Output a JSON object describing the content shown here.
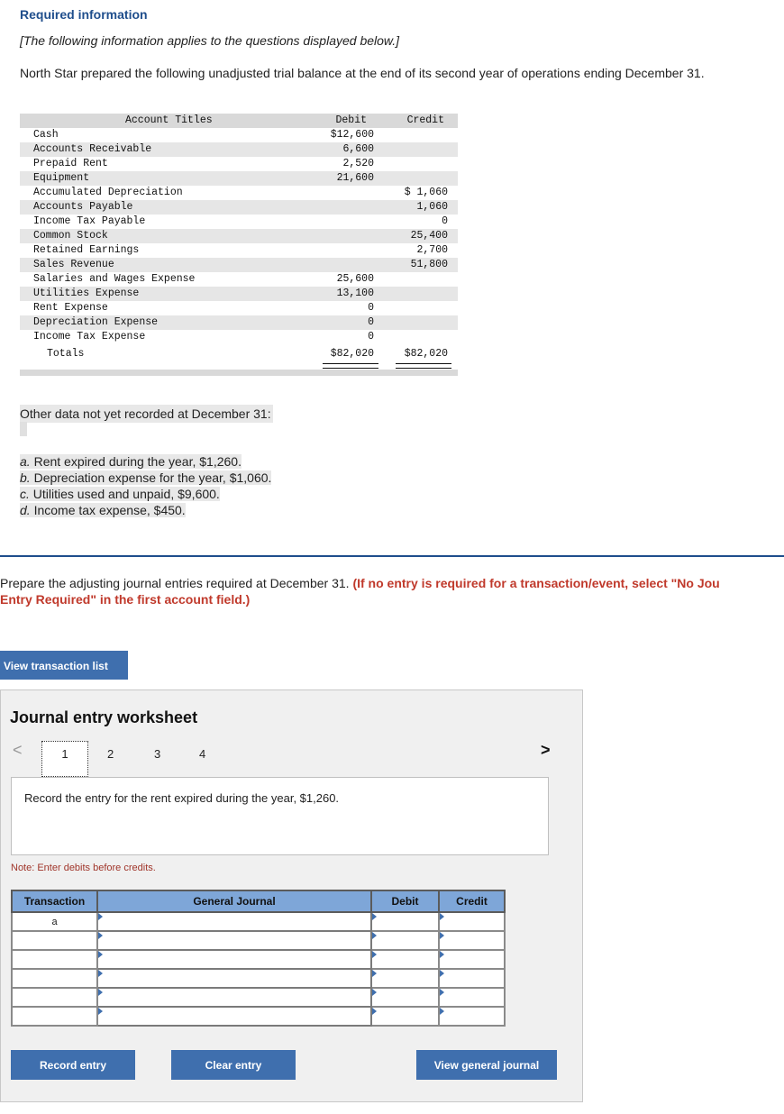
{
  "header": {
    "title": "Required information",
    "subtitle": "[The following information applies to the questions displayed below.]",
    "intro": "North Star prepared the following unadjusted trial balance at the end of its second year of operations ending December 31."
  },
  "trial_balance": {
    "headers": {
      "account": "Account Titles",
      "debit": "Debit",
      "credit": "Credit"
    },
    "rows": [
      {
        "name": "Cash",
        "debit": "$12,600",
        "credit": ""
      },
      {
        "name": "Accounts Receivable",
        "debit": "6,600",
        "credit": ""
      },
      {
        "name": "Prepaid Rent",
        "debit": "2,520",
        "credit": ""
      },
      {
        "name": "Equipment",
        "debit": "21,600",
        "credit": ""
      },
      {
        "name": "Accumulated Depreciation",
        "debit": "",
        "credit": "$ 1,060"
      },
      {
        "name": "Accounts Payable",
        "debit": "",
        "credit": "1,060"
      },
      {
        "name": "Income Tax Payable",
        "debit": "",
        "credit": "0"
      },
      {
        "name": "Common Stock",
        "debit": "",
        "credit": "25,400"
      },
      {
        "name": "Retained Earnings",
        "debit": "",
        "credit": "2,700"
      },
      {
        "name": "Sales Revenue",
        "debit": "",
        "credit": "51,800"
      },
      {
        "name": "Salaries and Wages Expense",
        "debit": "25,600",
        "credit": ""
      },
      {
        "name": "Utilities Expense",
        "debit": "13,100",
        "credit": ""
      },
      {
        "name": "Rent Expense",
        "debit": "0",
        "credit": ""
      },
      {
        "name": "Depreciation Expense",
        "debit": "0",
        "credit": ""
      },
      {
        "name": "Income Tax Expense",
        "debit": "0",
        "credit": ""
      }
    ],
    "totals": {
      "label": "Totals",
      "debit": "$82,020",
      "credit": "$82,020"
    }
  },
  "other_data": {
    "title": "Other data not yet recorded at December 31:",
    "items": [
      {
        "letter": "a.",
        "text": "Rent expired during the year, $1,260."
      },
      {
        "letter": "b.",
        "text": "Depreciation expense for the year, $1,060."
      },
      {
        "letter": "c.",
        "text": "Utilities used and unpaid, $9,600."
      },
      {
        "letter": "d.",
        "text": "Income tax expense, $450."
      }
    ]
  },
  "instructions": {
    "line1_plain": "Prepare the adjusting journal entries required at December 31. ",
    "line1_red": "(If no entry is required for a transaction/event, select \"No Jou",
    "line2_red": "Entry Required\" in the first account field.)"
  },
  "buttons": {
    "view_transaction_list": "View transaction list",
    "record_entry": "Record entry",
    "clear_entry": "Clear entry",
    "view_general_journal": "View general journal"
  },
  "worksheet": {
    "title": "Journal entry worksheet",
    "prev": "<",
    "next": ">",
    "pages": [
      "1",
      "2",
      "3",
      "4"
    ],
    "prompt": "Record the entry for the rent expired during the year, $1,260.",
    "note": "Note: Enter debits before credits.",
    "columns": {
      "transaction": "Transaction",
      "general_journal": "General Journal",
      "debit": "Debit",
      "credit": "Credit"
    },
    "rows": [
      {
        "transaction": "a"
      },
      {
        "transaction": ""
      },
      {
        "transaction": ""
      },
      {
        "transaction": ""
      },
      {
        "transaction": ""
      },
      {
        "transaction": ""
      }
    ]
  }
}
